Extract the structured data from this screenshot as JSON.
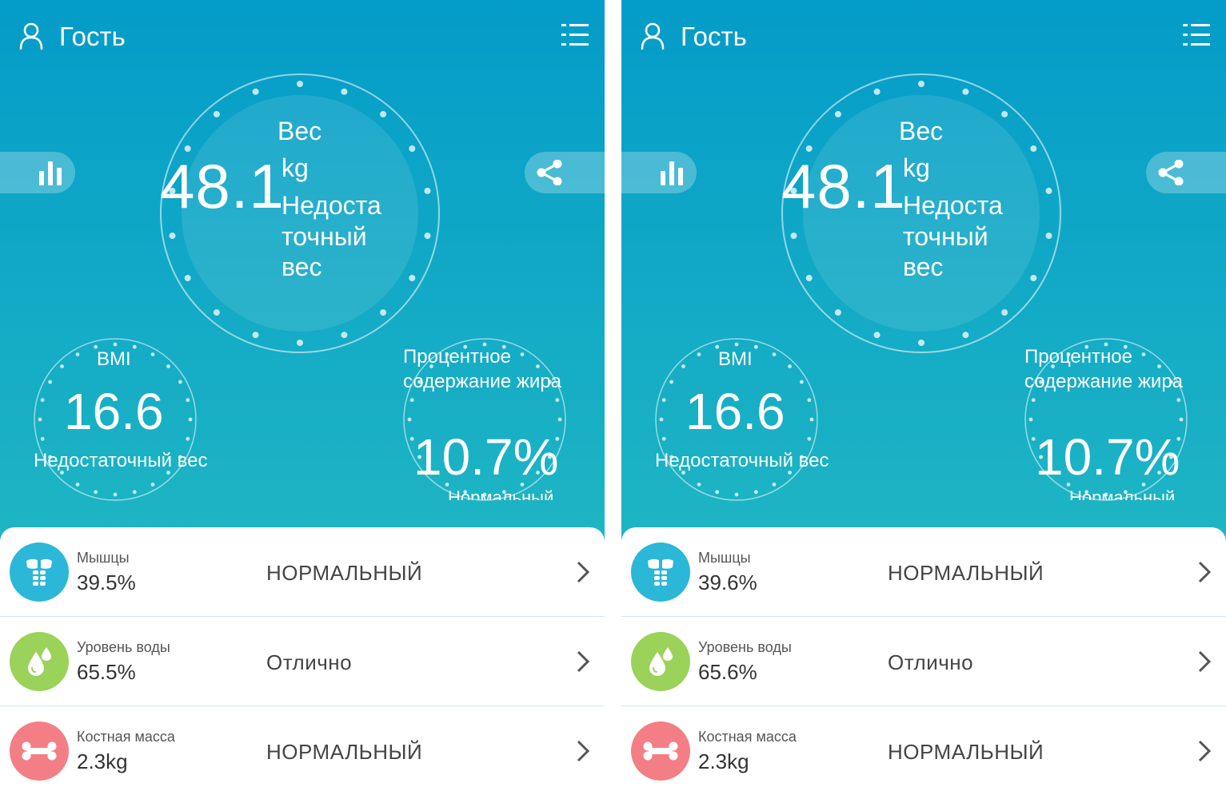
{
  "colors": {
    "header_top": "#049cc8",
    "header_bottom": "#1fb6c4",
    "muscle_icon_bg": "#2ab7d8",
    "water_icon_bg": "#9bd25a",
    "bone_icon_bg": "#f47e86"
  },
  "screens": [
    {
      "header": {
        "user_name": "Гость",
        "user_icon": "user-icon",
        "menu_icon": "list-menu-icon"
      },
      "buttons": {
        "chart_icon": "bar-chart-icon",
        "share_icon": "share-icon"
      },
      "weight": {
        "label": "Вес",
        "value": "48.1",
        "unit": "kg",
        "status": "Недоста точный вес"
      },
      "bmi": {
        "label": "BMI",
        "value": "16.6",
        "status": "Недостаточный вес"
      },
      "fat": {
        "label": "Процентное содержание жира",
        "value": "10.7%",
        "status": "Нормальный"
      },
      "rows": [
        {
          "icon": "muscle-icon",
          "name": "Мышцы",
          "value": "39.5%",
          "status": "НОРМАЛЬНЫЙ"
        },
        {
          "icon": "water-drop-icon",
          "name": "Уровень воды",
          "value": "65.5%",
          "status": "Отлично"
        },
        {
          "icon": "bone-icon",
          "name": "Костная масса",
          "value": "2.3kg",
          "status": "НОРМАЛЬНЫЙ"
        }
      ]
    },
    {
      "header": {
        "user_name": "Гость",
        "user_icon": "user-icon",
        "menu_icon": "list-menu-icon"
      },
      "buttons": {
        "chart_icon": "bar-chart-icon",
        "share_icon": "share-icon"
      },
      "weight": {
        "label": "Вес",
        "value": "48.1",
        "unit": "kg",
        "status": "Недоста точный вес"
      },
      "bmi": {
        "label": "BMI",
        "value": "16.6",
        "status": "Недостаточный вес"
      },
      "fat": {
        "label": "Процентное содержание жира",
        "value": "10.7%",
        "status": "Нормальный"
      },
      "rows": [
        {
          "icon": "muscle-icon",
          "name": "Мышцы",
          "value": "39.6%",
          "status": "НОРМАЛЬНЫЙ"
        },
        {
          "icon": "water-drop-icon",
          "name": "Уровень воды",
          "value": "65.6%",
          "status": "Отлично"
        },
        {
          "icon": "bone-icon",
          "name": "Костная масса",
          "value": "2.3kg",
          "status": "НОРМАЛЬНЫЙ"
        }
      ]
    }
  ]
}
